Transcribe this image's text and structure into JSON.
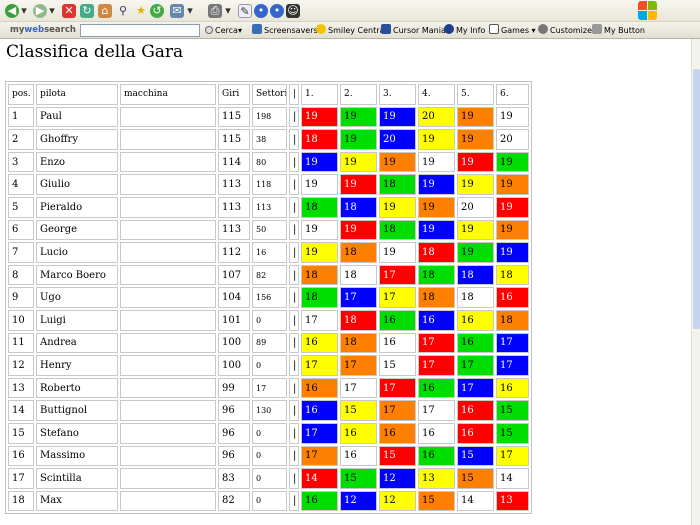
{
  "toolbar": {
    "brand_prefix": "my",
    "brand_web": "web",
    "brand_suffix": "search",
    "search_button": "Cerca",
    "items": [
      "Screensavers",
      "Smiley Central",
      "Cursor Mania",
      "My Info",
      "Games",
      "Customize",
      "My Button"
    ]
  },
  "page": {
    "title": "Classifica della Gara"
  },
  "table": {
    "headers": [
      "pos.",
      "pilota",
      "macchina",
      "Giri",
      "Settori",
      "|",
      "1.",
      "2.",
      "3.",
      "4.",
      "5.",
      "6."
    ],
    "rows": [
      {
        "pos": "1",
        "pilot": "Paul",
        "car": "",
        "laps": "115",
        "sectors": "198",
        "sep": "|",
        "cells": [
          {
            "v": "19",
            "c": "red"
          },
          {
            "v": "19",
            "c": "green"
          },
          {
            "v": "19",
            "c": "blue"
          },
          {
            "v": "20",
            "c": "yellow"
          },
          {
            "v": "19",
            "c": "orange"
          },
          {
            "v": "19",
            "c": "white"
          }
        ]
      },
      {
        "pos": "2",
        "pilot": "Ghoffry",
        "car": "",
        "laps": "115",
        "sectors": "38",
        "sep": "|",
        "cells": [
          {
            "v": "18",
            "c": "red"
          },
          {
            "v": "19",
            "c": "green"
          },
          {
            "v": "20",
            "c": "blue"
          },
          {
            "v": "19",
            "c": "yellow"
          },
          {
            "v": "19",
            "c": "orange"
          },
          {
            "v": "20",
            "c": "white"
          }
        ]
      },
      {
        "pos": "3",
        "pilot": "Enzo",
        "car": "",
        "laps": "114",
        "sectors": "80",
        "sep": "|",
        "cells": [
          {
            "v": "19",
            "c": "blue"
          },
          {
            "v": "19",
            "c": "yellow"
          },
          {
            "v": "19",
            "c": "orange"
          },
          {
            "v": "19",
            "c": "white"
          },
          {
            "v": "19",
            "c": "red"
          },
          {
            "v": "19",
            "c": "green"
          }
        ]
      },
      {
        "pos": "4",
        "pilot": "Giulio",
        "car": "",
        "laps": "113",
        "sectors": "118",
        "sep": "|",
        "cells": [
          {
            "v": "19",
            "c": "white"
          },
          {
            "v": "19",
            "c": "red"
          },
          {
            "v": "18",
            "c": "green"
          },
          {
            "v": "19",
            "c": "blue"
          },
          {
            "v": "19",
            "c": "yellow"
          },
          {
            "v": "19",
            "c": "orange"
          }
        ]
      },
      {
        "pos": "5",
        "pilot": "Pieraldo",
        "car": "",
        "laps": "113",
        "sectors": "113",
        "sep": "|",
        "cells": [
          {
            "v": "18",
            "c": "green"
          },
          {
            "v": "18",
            "c": "blue"
          },
          {
            "v": "19",
            "c": "yellow"
          },
          {
            "v": "19",
            "c": "orange"
          },
          {
            "v": "20",
            "c": "white"
          },
          {
            "v": "19",
            "c": "red"
          }
        ]
      },
      {
        "pos": "6",
        "pilot": "George",
        "car": "",
        "laps": "113",
        "sectors": "50",
        "sep": "|",
        "cells": [
          {
            "v": "19",
            "c": "white"
          },
          {
            "v": "19",
            "c": "red"
          },
          {
            "v": "18",
            "c": "green"
          },
          {
            "v": "19",
            "c": "blue"
          },
          {
            "v": "19",
            "c": "yellow"
          },
          {
            "v": "19",
            "c": "orange"
          }
        ]
      },
      {
        "pos": "7",
        "pilot": "Lucio",
        "car": "",
        "laps": "112",
        "sectors": "16",
        "sep": "|",
        "cells": [
          {
            "v": "19",
            "c": "yellow"
          },
          {
            "v": "18",
            "c": "orange"
          },
          {
            "v": "19",
            "c": "white"
          },
          {
            "v": "18",
            "c": "red"
          },
          {
            "v": "19",
            "c": "green"
          },
          {
            "v": "19",
            "c": "blue"
          }
        ]
      },
      {
        "pos": "8",
        "pilot": "Marco Boero",
        "car": "",
        "laps": "107",
        "sectors": "82",
        "sep": "|",
        "cells": [
          {
            "v": "18",
            "c": "orange"
          },
          {
            "v": "18",
            "c": "white"
          },
          {
            "v": "17",
            "c": "red"
          },
          {
            "v": "18",
            "c": "green"
          },
          {
            "v": "18",
            "c": "blue"
          },
          {
            "v": "18",
            "c": "yellow"
          }
        ]
      },
      {
        "pos": "9",
        "pilot": "Ugo",
        "car": "",
        "laps": "104",
        "sectors": "156",
        "sep": "|",
        "cells": [
          {
            "v": "18",
            "c": "green"
          },
          {
            "v": "17",
            "c": "blue"
          },
          {
            "v": "17",
            "c": "yellow"
          },
          {
            "v": "18",
            "c": "orange"
          },
          {
            "v": "18",
            "c": "white"
          },
          {
            "v": "16",
            "c": "red"
          }
        ]
      },
      {
        "pos": "10",
        "pilot": "Luigi",
        "car": "",
        "laps": "101",
        "sectors": "0",
        "sep": "|",
        "cells": [
          {
            "v": "17",
            "c": "white"
          },
          {
            "v": "18",
            "c": "red"
          },
          {
            "v": "16",
            "c": "green"
          },
          {
            "v": "16",
            "c": "blue"
          },
          {
            "v": "16",
            "c": "yellow"
          },
          {
            "v": "18",
            "c": "orange"
          }
        ]
      },
      {
        "pos": "11",
        "pilot": "Andrea",
        "car": "",
        "laps": "100",
        "sectors": "89",
        "sep": "|",
        "cells": [
          {
            "v": "16",
            "c": "yellow"
          },
          {
            "v": "18",
            "c": "orange"
          },
          {
            "v": "16",
            "c": "white"
          },
          {
            "v": "17",
            "c": "red"
          },
          {
            "v": "16",
            "c": "green"
          },
          {
            "v": "17",
            "c": "blue"
          }
        ]
      },
      {
        "pos": "12",
        "pilot": "Henry",
        "car": "",
        "laps": "100",
        "sectors": "0",
        "sep": "|",
        "cells": [
          {
            "v": "17",
            "c": "yellow"
          },
          {
            "v": "17",
            "c": "orange"
          },
          {
            "v": "15",
            "c": "white"
          },
          {
            "v": "17",
            "c": "red"
          },
          {
            "v": "17",
            "c": "green"
          },
          {
            "v": "17",
            "c": "blue"
          }
        ]
      },
      {
        "pos": "13",
        "pilot": "Roberto",
        "car": "",
        "laps": "99",
        "sectors": "17",
        "sep": "|",
        "cells": [
          {
            "v": "16",
            "c": "orange"
          },
          {
            "v": "17",
            "c": "white"
          },
          {
            "v": "17",
            "c": "red"
          },
          {
            "v": "16",
            "c": "green"
          },
          {
            "v": "17",
            "c": "blue"
          },
          {
            "v": "16",
            "c": "yellow"
          }
        ]
      },
      {
        "pos": "14",
        "pilot": "Buttignol",
        "car": "",
        "laps": "96",
        "sectors": "130",
        "sep": "|",
        "cells": [
          {
            "v": "16",
            "c": "blue"
          },
          {
            "v": "15",
            "c": "yellow"
          },
          {
            "v": "17",
            "c": "orange"
          },
          {
            "v": "17",
            "c": "white"
          },
          {
            "v": "16",
            "c": "red"
          },
          {
            "v": "15",
            "c": "green"
          }
        ]
      },
      {
        "pos": "15",
        "pilot": "Stefano",
        "car": "",
        "laps": "96",
        "sectors": "0",
        "sep": "|",
        "cells": [
          {
            "v": "17",
            "c": "blue"
          },
          {
            "v": "16",
            "c": "yellow"
          },
          {
            "v": "16",
            "c": "orange"
          },
          {
            "v": "16",
            "c": "white"
          },
          {
            "v": "16",
            "c": "red"
          },
          {
            "v": "15",
            "c": "green"
          }
        ]
      },
      {
        "pos": "16",
        "pilot": "Massimo",
        "car": "",
        "laps": "96",
        "sectors": "0",
        "sep": "|",
        "cells": [
          {
            "v": "17",
            "c": "orange"
          },
          {
            "v": "16",
            "c": "white"
          },
          {
            "v": "15",
            "c": "red"
          },
          {
            "v": "16",
            "c": "green"
          },
          {
            "v": "15",
            "c": "blue"
          },
          {
            "v": "17",
            "c": "yellow"
          }
        ]
      },
      {
        "pos": "17",
        "pilot": "Scintilla",
        "car": "",
        "laps": "83",
        "sectors": "0",
        "sep": "|",
        "cells": [
          {
            "v": "14",
            "c": "red"
          },
          {
            "v": "15",
            "c": "green"
          },
          {
            "v": "12",
            "c": "blue"
          },
          {
            "v": "13",
            "c": "yellow"
          },
          {
            "v": "15",
            "c": "orange"
          },
          {
            "v": "14",
            "c": "white"
          }
        ]
      },
      {
        "pos": "18",
        "pilot": "Max",
        "car": "",
        "laps": "82",
        "sectors": "0",
        "sep": "|",
        "cells": [
          {
            "v": "16",
            "c": "green"
          },
          {
            "v": "12",
            "c": "blue"
          },
          {
            "v": "12",
            "c": "yellow"
          },
          {
            "v": "15",
            "c": "orange"
          },
          {
            "v": "14",
            "c": "white"
          },
          {
            "v": "13",
            "c": "red"
          }
        ]
      }
    ]
  },
  "colors": {
    "red": "#ff0000",
    "green": "#00dd00",
    "blue": "#0000ff",
    "yellow": "#ffff00",
    "orange": "#ff7f00",
    "white": "#ffffff"
  }
}
